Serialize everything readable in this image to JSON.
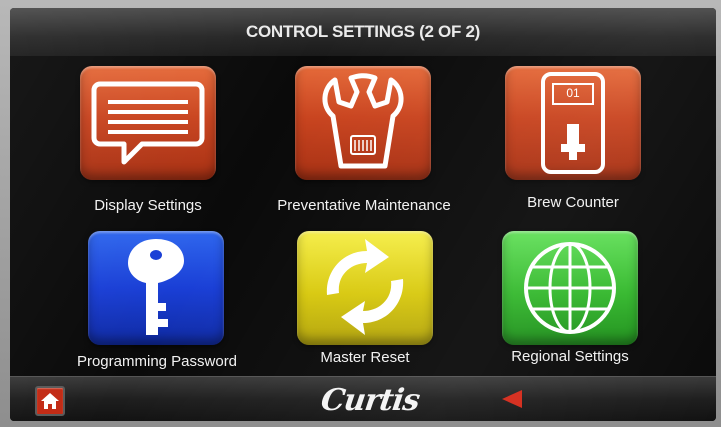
{
  "header": {
    "title": "CONTROL SETTINGS (2 OF 2)"
  },
  "tiles": [
    {
      "label": "Display Settings",
      "icon": "display-settings-icon",
      "color": "#c9441f"
    },
    {
      "label": "Preventative Maintenance",
      "icon": "wrench-icon",
      "color": "#c9441f"
    },
    {
      "label": "Brew Counter",
      "icon": "brew-counter-icon",
      "color": "#c9441f",
      "counter": "01"
    },
    {
      "label": "Programming Password",
      "icon": "key-icon",
      "color": "#1a3fd6"
    },
    {
      "label": "Master Reset",
      "icon": "reset-arrows-icon",
      "color": "#d8c90f"
    },
    {
      "label": "Regional Settings",
      "icon": "globe-icon",
      "color": "#34b82d"
    }
  ],
  "footer": {
    "home_icon": "home-icon",
    "brand": "Curtis",
    "back_icon": "back-arrow-icon",
    "back_color": "#d42a1a"
  }
}
